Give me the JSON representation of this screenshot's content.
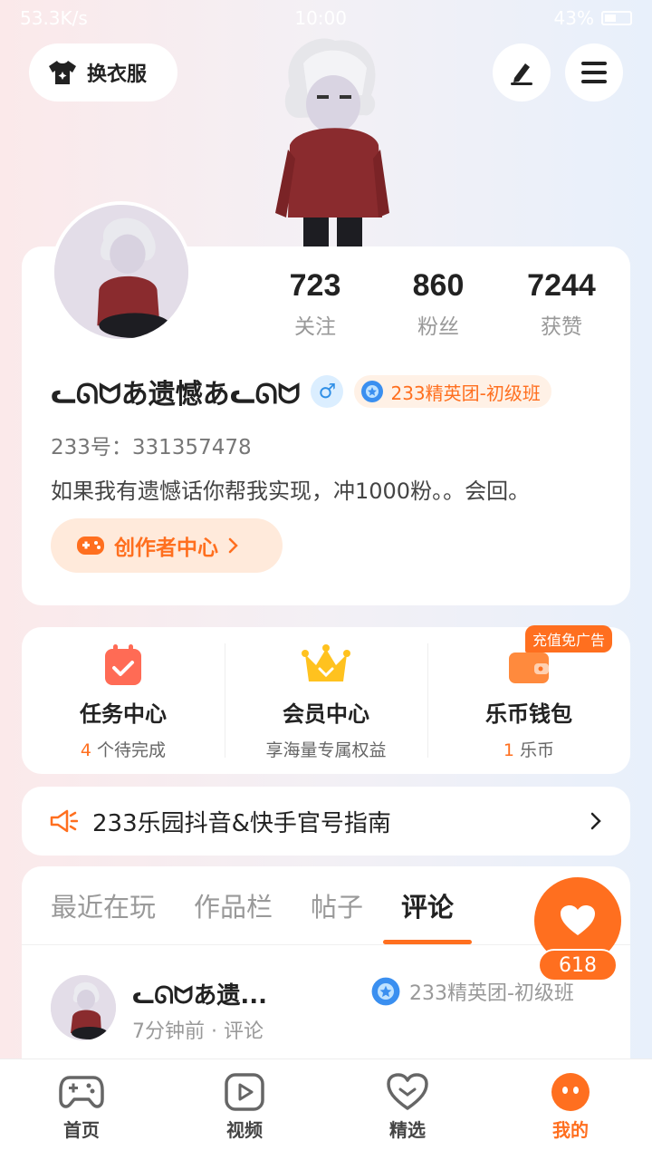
{
  "status_bar": {
    "network_speed": "53.3K/s",
    "time": "10:00",
    "battery": "43%"
  },
  "header": {
    "outfit_button_label": "换衣服"
  },
  "profile": {
    "stats": [
      {
        "value": "723",
        "label": "关注"
      },
      {
        "value": "860",
        "label": "粉丝"
      },
      {
        "value": "7244",
        "label": "获赞"
      }
    ],
    "nickname": "ᓚᘏᗢあ遗憾あᓚᘏᗢ",
    "gender_symbol": "♂",
    "badge": "233精英团-初级班",
    "uid": "233号：331357478",
    "bio": "如果我有遗憾话你帮我实现，冲1000粉。。会回。",
    "creator_button_label": "创作者中心"
  },
  "quick_actions": [
    {
      "title": "任务中心",
      "sub_highlight": "4",
      "sub_text": " 个待完成"
    },
    {
      "title": "会员中心",
      "sub_highlight": "",
      "sub_text": "享海量专属权益"
    },
    {
      "title": "乐币钱包",
      "sub_highlight": "1",
      "sub_text": " 乐币",
      "tag": "充值免广告"
    }
  ],
  "notice": {
    "text": "233乐园抖音&快手官号指南"
  },
  "tabs": [
    {
      "label": "最近在玩"
    },
    {
      "label": "作品栏"
    },
    {
      "label": "帖子"
    },
    {
      "label": "评论"
    }
  ],
  "like": {
    "count": "618"
  },
  "comment": {
    "name": "ᓚᘏᗢあ遗...",
    "meta": "7分钟前 · 评论",
    "badge": "233精英团-初级班"
  },
  "bottom_nav": [
    {
      "label": "首页",
      "icon": "gamepad-icon"
    },
    {
      "label": "视频",
      "icon": "video-icon"
    },
    {
      "label": "精选",
      "icon": "heart-check-icon"
    },
    {
      "label": "我的",
      "icon": "profile-face-icon"
    }
  ],
  "colors": {
    "accent": "#ff6f1f",
    "gender_blue": "#2f8fe6"
  }
}
